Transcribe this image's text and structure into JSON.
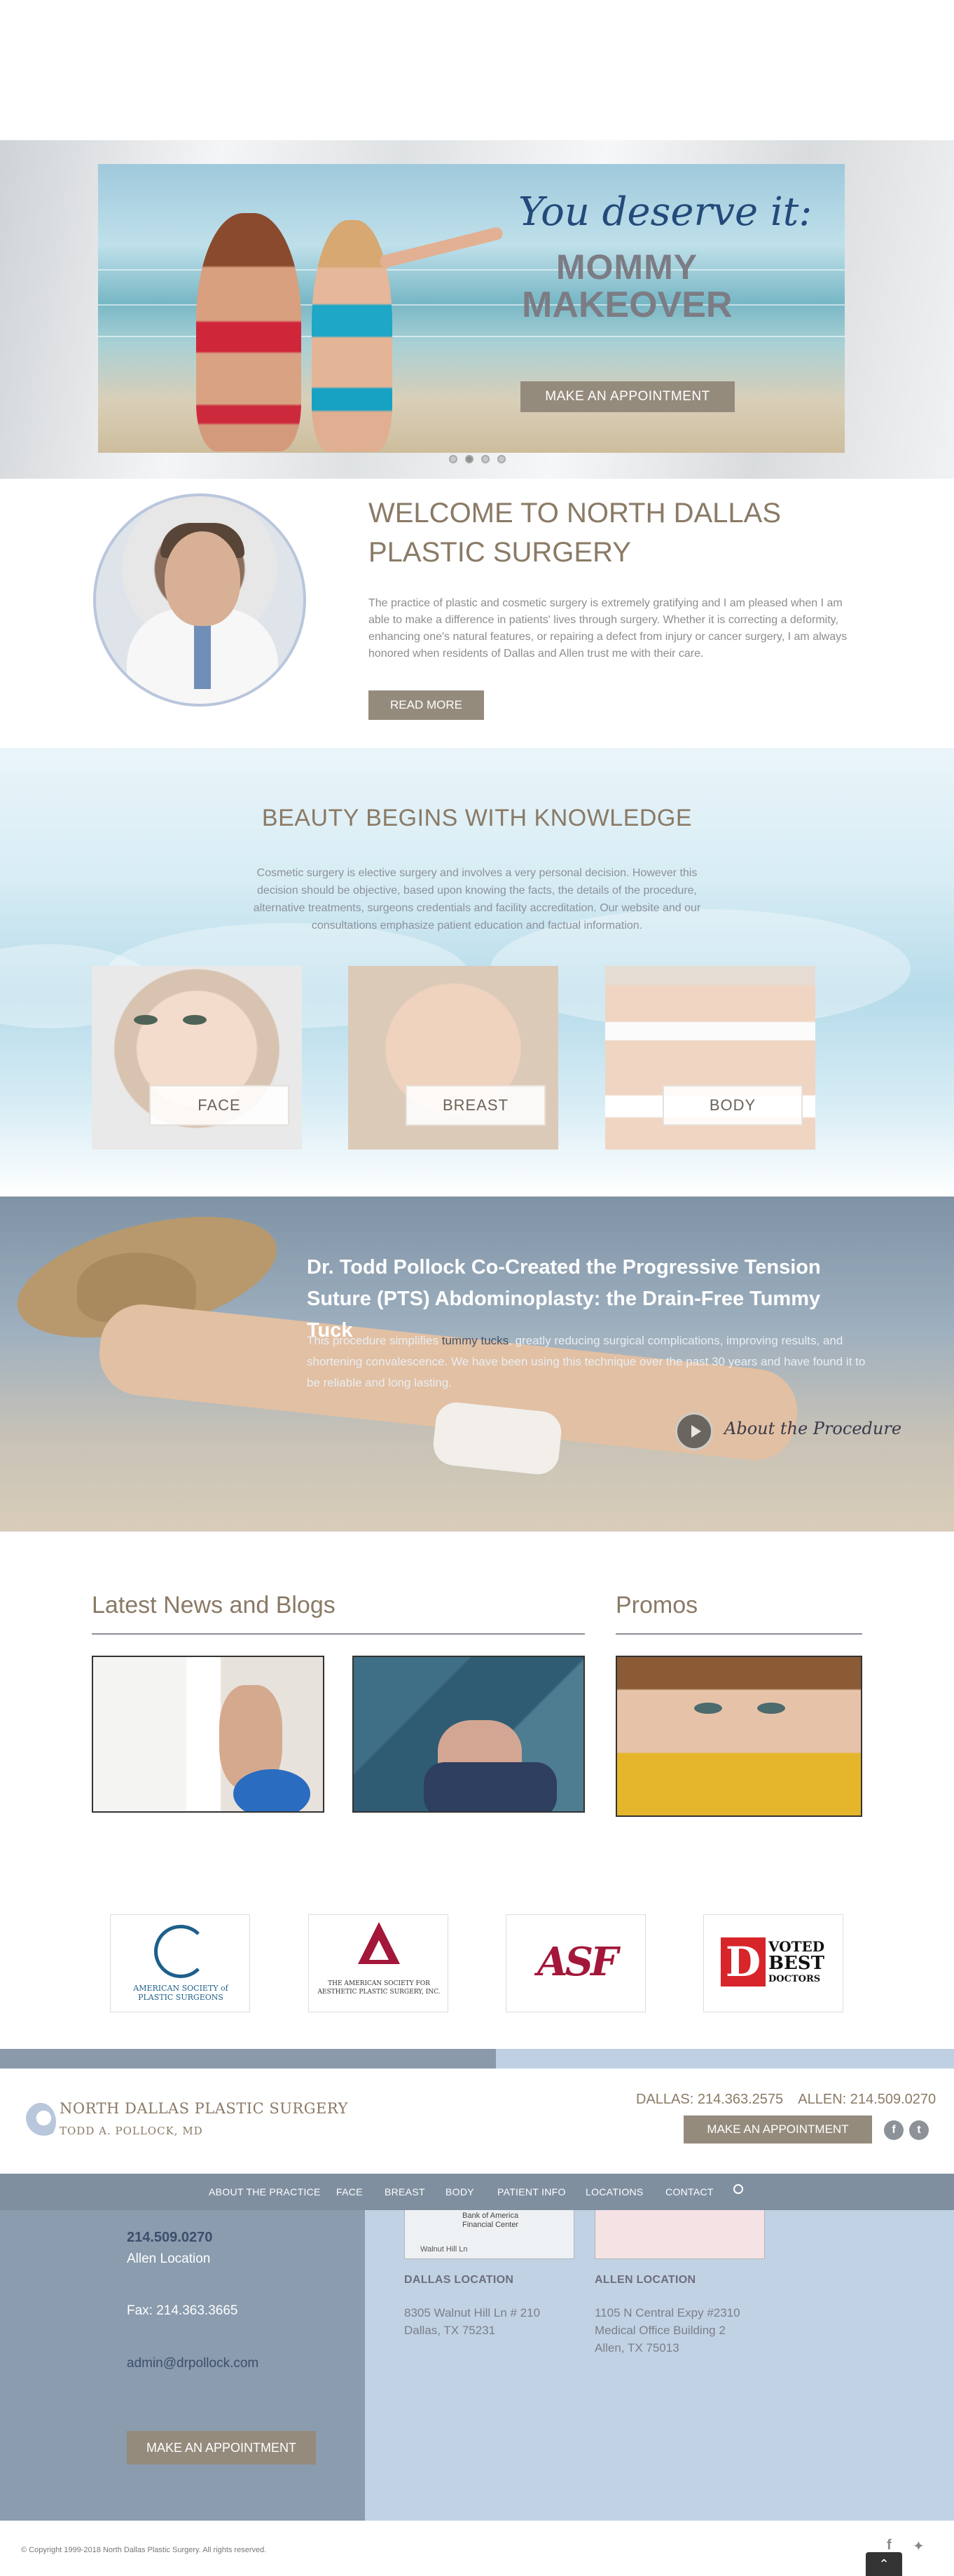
{
  "hero": {
    "script_heading": "You deserve it:",
    "title_line1": "MOMMY",
    "title_line2": "MAKEOVER",
    "cta_label": "MAKE AN APPOINTMENT",
    "slides": 4,
    "active_slide": 2
  },
  "welcome": {
    "title": "WELCOME TO NORTH DALLAS PLASTIC SURGERY",
    "body": "The practice of plastic and cosmetic surgery is extremely gratifying and I am pleased when I am able to make a difference in patients' lives through surgery. Whether it is correcting a deformity, enhancing one's natural features, or repairing a defect from injury or cancer surgery, I am always honored when residents of Dallas and Allen trust me with their care.",
    "read_more_label": "READ MORE"
  },
  "knowledge": {
    "title": "BEAUTY BEGINS WITH KNOWLEDGE",
    "body": "Cosmetic surgery is elective surgery and involves a very personal decision. However this decision should be objective, based upon knowing the facts, the details of the procedure, alternative treatments, surgeons credentials and facility accreditation. Our website and our consultations emphasize patient education and factual information.",
    "categories": [
      "FACE",
      "BREAST",
      "BODY"
    ]
  },
  "pts": {
    "title": "Dr. Todd Pollock Co-Created the Progressive Tension Suture (PTS) Abdominoplasty: the Drain-Free Tummy Tuck",
    "text_before_link": "This procedure simplifies ",
    "link_text": "tummy tucks",
    "text_after_link": ", greatly reducing surgical complications, improving results, and shortening convalescence. We have been using this technique over the past 30 years and have found it to be reliable and long lasting.",
    "about_label": "About the Procedure"
  },
  "news": {
    "title": "Latest News and Blogs",
    "promos_title": "Promos"
  },
  "associations": [
    {
      "name": "AMERICAN SOCIETY of PLASTIC SURGEONS"
    },
    {
      "name": "THE AMERICAN SOCIETY FOR AESTHETIC PLASTIC SURGERY, INC."
    },
    {
      "name": "ASF"
    },
    {
      "name_top": "VOTED",
      "name_bottom": "BEST",
      "name_sub": "DOCTORS",
      "letter": "D"
    }
  ],
  "footer": {
    "brand_name": "NORTH DALLAS PLASTIC SURGERY",
    "brand_sub": "TODD A. POLLOCK, MD",
    "phones": "DALLAS: 214.363.2575    ALLEN: 214.509.0270",
    "cta_label": "MAKE AN APPOINTMENT",
    "nav": [
      "ABOUT THE PRACTICE",
      "FACE",
      "BREAST",
      "BODY",
      "PATIENT INFO",
      "LOCATIONS",
      "CONTACT"
    ],
    "allen_phone": "214.509.0270",
    "allen_label": "Allen Location",
    "fax": "Fax: 214.363.3665",
    "email": "admin@drpollock.com",
    "cta2_label": "MAKE AN APPOINTMENT",
    "map_dallas_label": "Bank of America Financial Center",
    "map_street": "Walnut Hill Ln",
    "dallas": {
      "heading": "DALLAS LOCATION",
      "line1": "8305 Walnut Hill Ln # 210",
      "line2": "Dallas, TX 75231"
    },
    "allen": {
      "heading": "ALLEN LOCATION",
      "line1": "1105 N Central Expy #2310",
      "line2": "Medical Office Building 2",
      "line3": "Allen, TX 75013"
    },
    "copyright": "© Copyright 1999-2018 North Dallas Plastic Surgery. All rights reserved."
  },
  "colors": {
    "accent_button": "#958b7d",
    "heading_brown": "#8a7a66",
    "nav_bg": "#7f8f9f",
    "link_navy": "#3d4e6c"
  }
}
